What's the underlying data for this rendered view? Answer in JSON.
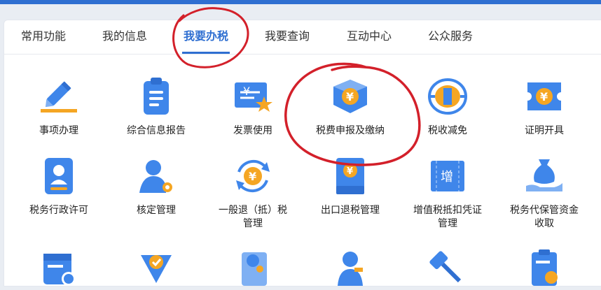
{
  "tabs": [
    {
      "label": "常用功能",
      "active": false
    },
    {
      "label": "我的信息",
      "active": false
    },
    {
      "label": "我要办税",
      "active": true
    },
    {
      "label": "我要查询",
      "active": false
    },
    {
      "label": "互动中心",
      "active": false
    },
    {
      "label": "公众服务",
      "active": false
    }
  ],
  "row1": [
    {
      "label": "事项办理",
      "icon": "pen-icon"
    },
    {
      "label": "综合信息报告",
      "icon": "clipboard-icon"
    },
    {
      "label": "发票使用",
      "icon": "invoice-star-icon"
    },
    {
      "label": "税费申报及缴纳",
      "icon": "yuan-box-icon"
    },
    {
      "label": "税收减免",
      "icon": "tax-shield-icon"
    },
    {
      "label": "证明开具",
      "icon": "yuan-ticket-icon"
    }
  ],
  "row2": [
    {
      "label": "税务行政许可",
      "icon": "person-card-icon"
    },
    {
      "label": "核定管理",
      "icon": "person-gear-icon"
    },
    {
      "label_line1": "一般退（抵）税",
      "label_line2": "管理",
      "icon": "yuan-refresh-icon"
    },
    {
      "label": "出口退税管理",
      "icon": "yuan-book-icon"
    },
    {
      "label_line1": "增值税抵扣凭证",
      "label_line2": "管理",
      "icon": "vat-ticket-icon"
    },
    {
      "label_line1": "税务代保管资金",
      "label_line2": "收取",
      "icon": "money-bag-hand-icon"
    }
  ],
  "row3": [
    {
      "icon": "calendar-clock-icon"
    },
    {
      "icon": "check-shield-icon"
    },
    {
      "icon": "person-document-icon"
    },
    {
      "icon": "person-badge-icon"
    },
    {
      "icon": "gavel-icon"
    },
    {
      "icon": "document-yuan-icon"
    }
  ],
  "glyphs": {
    "yuan": "¥",
    "vat": "增"
  },
  "colors": {
    "accent": "#2f6fd1",
    "icon_blue": "#3f86ea",
    "icon_orange": "#f5a623",
    "annotation": "#d3202a"
  }
}
